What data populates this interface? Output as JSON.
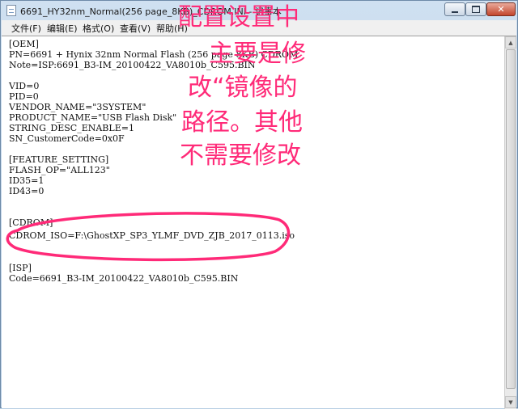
{
  "window": {
    "title": "6691_HY32nm_Normal(256 page_8KB)_CDROM.INI - 记事本",
    "controls": {
      "minimize": "–",
      "maximize": "□",
      "close": "✕"
    }
  },
  "menu": [
    "文件(F)",
    "编辑(E)",
    "格式(O)",
    "查看(V)",
    "帮助(H)"
  ],
  "document": {
    "lines": [
      "[OEM]",
      "PN=6691 + Hynix 32nm Normal Flash (256 page 8KB) CDROM",
      "Note=ISP:6691_B3-IM_20100422_VA8010b_C595.BIN",
      "",
      "VID=0",
      "PID=0",
      "VENDOR_NAME=\"3SYSTEM\"",
      "PRODUCT_NAME=\"USB Flash Disk\"",
      "STRING_DESC_ENABLE=1",
      "SN_CustomerCode=0x0F",
      "",
      "[FEATURE_SETTING]",
      "FLASH_OP=\"ALL123\"",
      "ID35=1",
      "ID43=0",
      "",
      "",
      "[CDROM]",
      "CDROM_ISO=F:\\GhostXP_SP3_YLMF_DVD_ZJB_2017_0113.iso",
      "",
      "",
      "[ISP]",
      "Code=6691_B3-IM_20100422_VA8010b_C595.BIN"
    ]
  },
  "annotation": {
    "lines": [
      "配置设置中",
      "主要是修",
      "改“镜像的",
      "路径。其他",
      "不需要修改"
    ],
    "color": "#ff2a78"
  }
}
